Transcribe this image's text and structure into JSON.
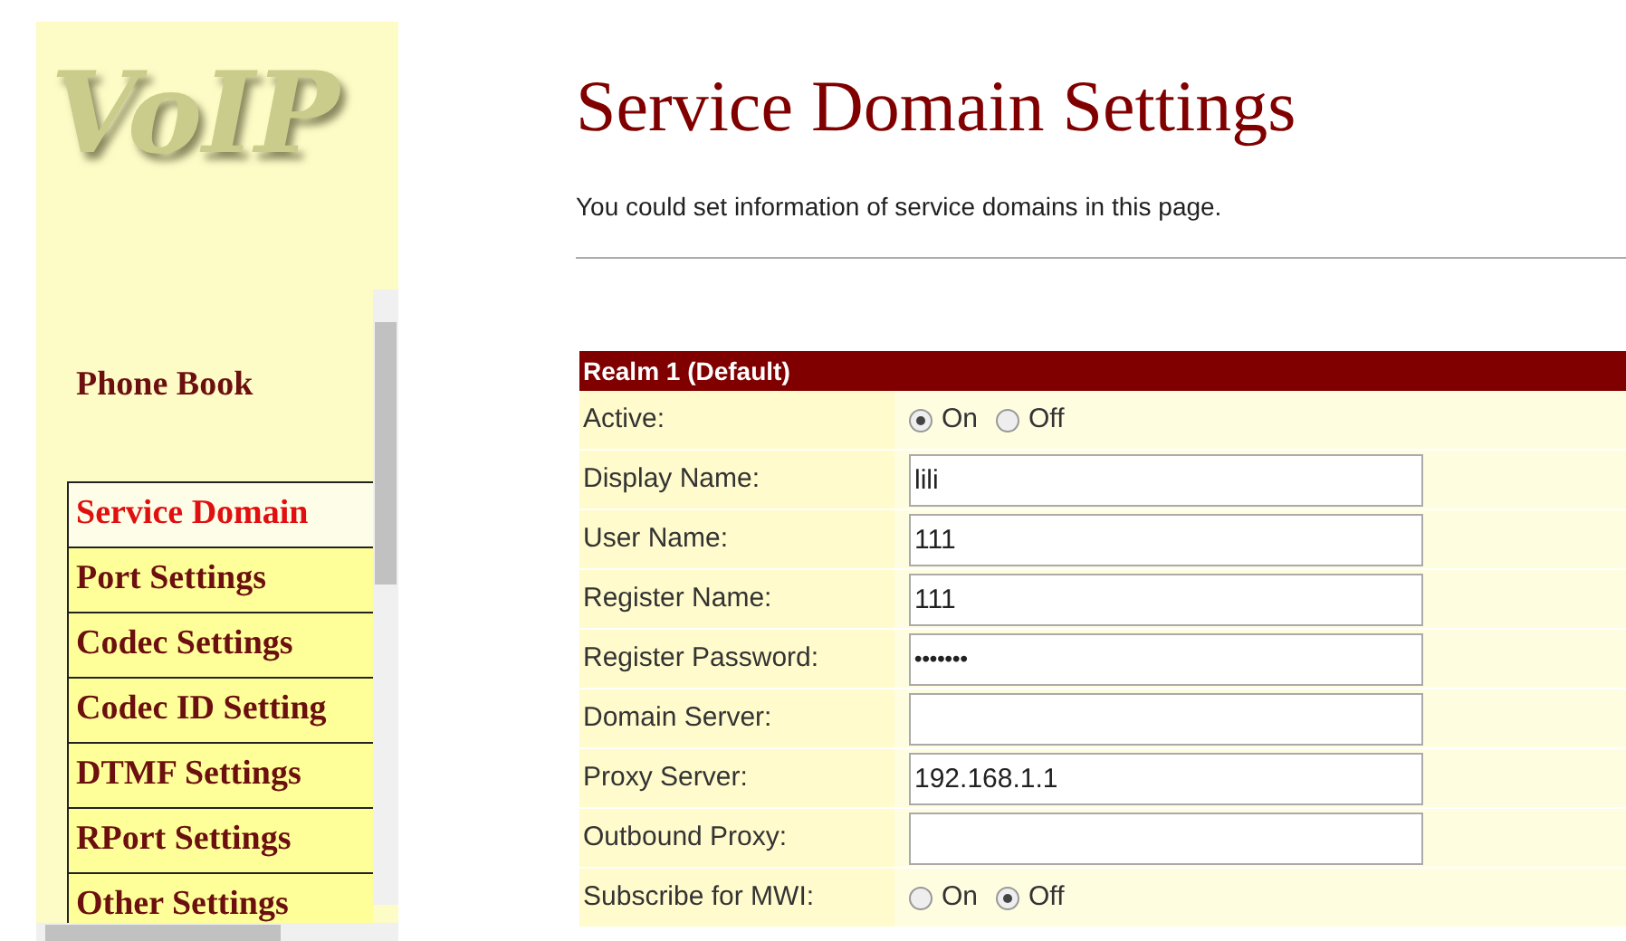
{
  "logo": {
    "text": "VoIP"
  },
  "sidebar": {
    "heading": "Phone Book",
    "items": [
      {
        "label": "Service Domain",
        "selected": true
      },
      {
        "label": "Port Settings",
        "selected": false
      },
      {
        "label": "Codec Settings",
        "selected": false
      },
      {
        "label": "Codec ID Setting",
        "selected": false
      },
      {
        "label": "DTMF Settings",
        "selected": false
      },
      {
        "label": "RPort Settings",
        "selected": false
      },
      {
        "label": "Other Settings",
        "selected": false
      }
    ]
  },
  "page": {
    "title": "Service Domain Settings",
    "description": "You could set information of service domains in this page."
  },
  "realm": {
    "header": "Realm 1 (Default)",
    "rows": [
      {
        "kind": "radio",
        "label": "Active:",
        "options": [
          {
            "label": "On",
            "selected": true
          },
          {
            "label": "Off",
            "selected": false
          }
        ]
      },
      {
        "kind": "text",
        "label": "Display Name:",
        "value": "lili"
      },
      {
        "kind": "text",
        "label": "User Name:",
        "value": "111"
      },
      {
        "kind": "text",
        "label": "Register Name:",
        "value": "111"
      },
      {
        "kind": "password",
        "label": "Register Password:",
        "value": "•••••••"
      },
      {
        "kind": "text",
        "label": "Domain Server:",
        "value": ""
      },
      {
        "kind": "text",
        "label": "Proxy Server:",
        "value": "192.168.1.1"
      },
      {
        "kind": "text",
        "label": "Outbound Proxy:",
        "value": ""
      },
      {
        "kind": "radio",
        "label": "Subscribe for MWI:",
        "options": [
          {
            "label": "On",
            "selected": false
          },
          {
            "label": "Off",
            "selected": true
          }
        ]
      }
    ]
  }
}
